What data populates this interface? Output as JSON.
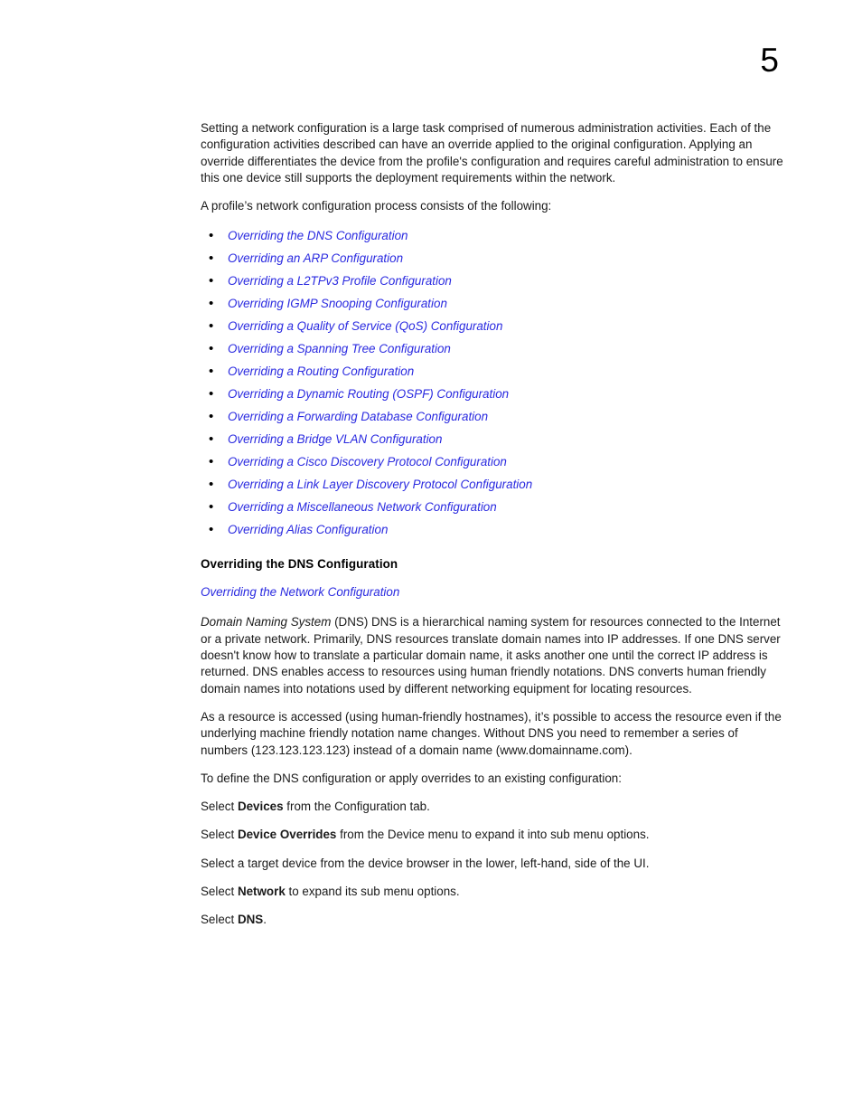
{
  "page": {
    "number": "5"
  },
  "intro": {
    "paragraph1": "Setting a network configuration is a large task comprised of numerous administration activities. Each of the configuration activities described can have an override applied to the original configuration. Applying an override differentiates the device from the profile's configuration and requires careful administration to ensure this one device still supports the deployment requirements within the network.",
    "paragraph2": "A profile’s network configuration process consists of the following:"
  },
  "link_list": {
    "bullet_glyph": "•",
    "items": [
      {
        "label": "Overriding the DNS Configuration"
      },
      {
        "label": "Overriding an ARP Configuration"
      },
      {
        "label": "Overriding a L2TPv3 Profile Configuration"
      },
      {
        "label": "Overriding IGMP Snooping Configuration"
      },
      {
        "label": "Overriding a Quality of Service (QoS) Configuration"
      },
      {
        "label": "Overriding a Spanning Tree Configuration"
      },
      {
        "label": "Overriding a Routing Configuration"
      },
      {
        "label": "Overriding a Dynamic Routing (OSPF) Configuration"
      },
      {
        "label": "Overriding a Forwarding Database Configuration"
      },
      {
        "label": "Overriding a Bridge VLAN Configuration"
      },
      {
        "label": "Overriding a Cisco Discovery Protocol Configuration"
      },
      {
        "label": "Overriding a Link Layer Discovery Protocol Configuration"
      },
      {
        "label": "Overriding a Miscellaneous Network Configuration"
      },
      {
        "label": "Overriding Alias Configuration"
      }
    ]
  },
  "section": {
    "heading": "Overriding the DNS Configuration",
    "parent_link": "Overriding the Network Configuration",
    "dns_para_lead_italic": "Domain Naming System",
    "dns_para_rest": " (DNS) DNS is a hierarchical naming system for resources connected to the Internet or a private network. Primarily, DNS resources translate domain names into IP addresses. If one DNS server doesn't know how to translate a particular domain name, it asks another one until the correct IP address is returned. DNS enables access to resources using human friendly notations. DNS converts human friendly domain names into notations used by different networking equipment for locating resources.",
    "resource_para": "As a resource is accessed (using human-friendly hostnames), it’s possible to access the resource even if the underlying machine friendly notation name changes. Without DNS you need to remember a series of numbers (123.123.123.123) instead of a domain name (www.domainname.com).",
    "steps_intro": "To define the DNS configuration or apply overrides to an existing configuration:"
  },
  "steps": {
    "step1_pre": "Select ",
    "step1_bold": "Devices",
    "step1_post": " from the Configuration tab.",
    "step2_pre": "Select ",
    "step2_bold": "Device Overrides",
    "step2_post": " from the Device menu to expand it into sub menu options.",
    "step3_full": "Select a target device from the device browser in the lower, left-hand, side of the UI.",
    "step4_pre": "Select ",
    "step4_bold": "Network",
    "step4_post": " to expand its sub menu options.",
    "step5_pre": "Select ",
    "step5_bold": "DNS",
    "step5_post": "."
  },
  "colors": {
    "link": "#2a2ae0",
    "text": "#1a1a1a",
    "page_background": "#ffffff"
  }
}
